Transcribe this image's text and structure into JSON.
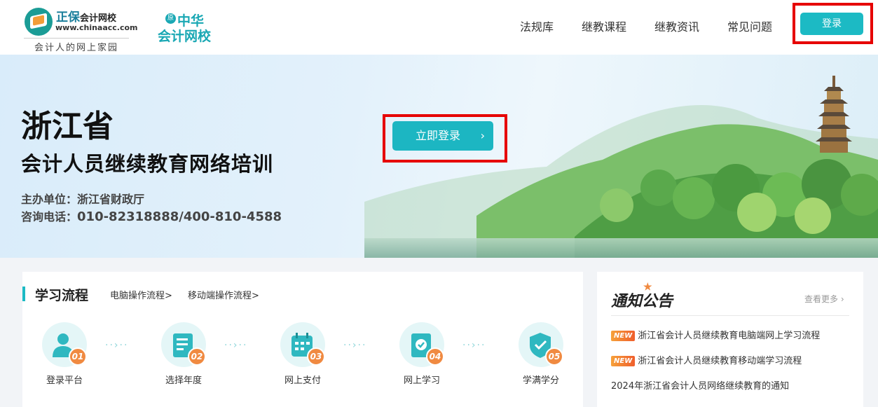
{
  "header": {
    "logo": {
      "brand": "正保",
      "brand_tail": "会计网校",
      "url": "www.chinaacc.com",
      "slogan": "会计人的网上家园"
    },
    "logo2": {
      "badge": "原",
      "line1": "中华",
      "line2": "会计网校"
    },
    "nav": [
      "法规库",
      "继教课程",
      "继教资讯",
      "常见问题"
    ],
    "login_label": "登录"
  },
  "banner": {
    "title": "浙江省",
    "subtitle": "会计人员继续教育网络培训",
    "host_label": "主办单位：",
    "host_value": "浙江省财政厅",
    "phone_label": "咨询电话：",
    "phone_value": "010-82318888/400-810-4588",
    "cta_label": "立即登录",
    "cta_arrow": "›"
  },
  "process": {
    "title": "学习流程",
    "links": [
      "电脑操作流程>",
      "移动端操作流程>"
    ],
    "connector": "··›··",
    "steps": [
      {
        "num": "01",
        "label": "登录平台",
        "icon": "user-icon"
      },
      {
        "num": "02",
        "label": "选择年度",
        "icon": "document-icon"
      },
      {
        "num": "03",
        "label": "网上支付",
        "icon": "calendar-icon"
      },
      {
        "num": "04",
        "label": "网上学习",
        "icon": "study-icon"
      },
      {
        "num": "05",
        "label": "学满学分",
        "icon": "shield-check-icon"
      }
    ]
  },
  "notice": {
    "title": "通知公告",
    "more_label": "查看更多",
    "new_badge": "NEW",
    "items": [
      {
        "text": "浙江省会计人员继续教育电脑端网上学习流程",
        "is_new": true
      },
      {
        "text": "浙江省会计人员继续教育移动端学习流程",
        "is_new": true
      },
      {
        "text": "2024年浙江省会计人员网络继续教育的通知",
        "is_new": false
      }
    ]
  },
  "colors": {
    "accent": "#1cbac4",
    "highlight": "#e60000",
    "step_number": "#f08a41"
  }
}
